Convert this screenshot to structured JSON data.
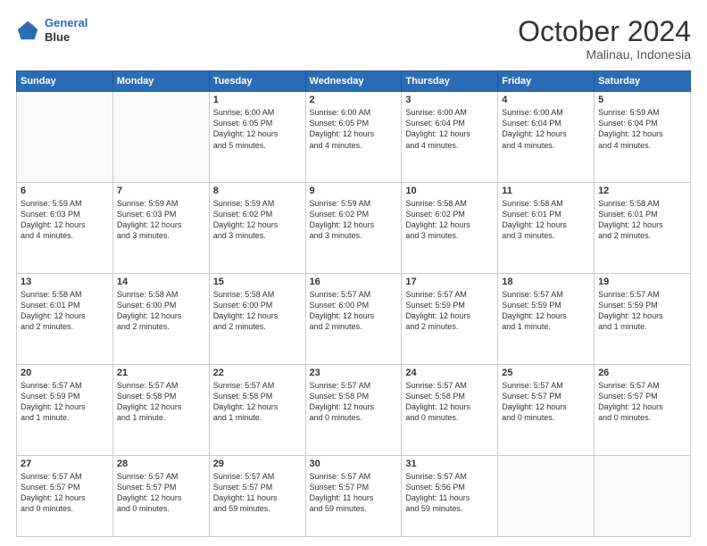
{
  "header": {
    "logo_line1": "General",
    "logo_line2": "Blue",
    "month": "October 2024",
    "location": "Malinau, Indonesia"
  },
  "weekdays": [
    "Sunday",
    "Monday",
    "Tuesday",
    "Wednesday",
    "Thursday",
    "Friday",
    "Saturday"
  ],
  "weeks": [
    [
      {
        "day": "",
        "text": ""
      },
      {
        "day": "",
        "text": ""
      },
      {
        "day": "1",
        "text": "Sunrise: 6:00 AM\nSunset: 6:05 PM\nDaylight: 12 hours\nand 5 minutes."
      },
      {
        "day": "2",
        "text": "Sunrise: 6:00 AM\nSunset: 6:05 PM\nDaylight: 12 hours\nand 4 minutes."
      },
      {
        "day": "3",
        "text": "Sunrise: 6:00 AM\nSunset: 6:04 PM\nDaylight: 12 hours\nand 4 minutes."
      },
      {
        "day": "4",
        "text": "Sunrise: 6:00 AM\nSunset: 6:04 PM\nDaylight: 12 hours\nand 4 minutes."
      },
      {
        "day": "5",
        "text": "Sunrise: 5:59 AM\nSunset: 6:04 PM\nDaylight: 12 hours\nand 4 minutes."
      }
    ],
    [
      {
        "day": "6",
        "text": "Sunrise: 5:59 AM\nSunset: 6:03 PM\nDaylight: 12 hours\nand 4 minutes."
      },
      {
        "day": "7",
        "text": "Sunrise: 5:59 AM\nSunset: 6:03 PM\nDaylight: 12 hours\nand 3 minutes."
      },
      {
        "day": "8",
        "text": "Sunrise: 5:59 AM\nSunset: 6:02 PM\nDaylight: 12 hours\nand 3 minutes."
      },
      {
        "day": "9",
        "text": "Sunrise: 5:59 AM\nSunset: 6:02 PM\nDaylight: 12 hours\nand 3 minutes."
      },
      {
        "day": "10",
        "text": "Sunrise: 5:58 AM\nSunset: 6:02 PM\nDaylight: 12 hours\nand 3 minutes."
      },
      {
        "day": "11",
        "text": "Sunrise: 5:58 AM\nSunset: 6:01 PM\nDaylight: 12 hours\nand 3 minutes."
      },
      {
        "day": "12",
        "text": "Sunrise: 5:58 AM\nSunset: 6:01 PM\nDaylight: 12 hours\nand 2 minutes."
      }
    ],
    [
      {
        "day": "13",
        "text": "Sunrise: 5:58 AM\nSunset: 6:01 PM\nDaylight: 12 hours\nand 2 minutes."
      },
      {
        "day": "14",
        "text": "Sunrise: 5:58 AM\nSunset: 6:00 PM\nDaylight: 12 hours\nand 2 minutes."
      },
      {
        "day": "15",
        "text": "Sunrise: 5:58 AM\nSunset: 6:00 PM\nDaylight: 12 hours\nand 2 minutes."
      },
      {
        "day": "16",
        "text": "Sunrise: 5:57 AM\nSunset: 6:00 PM\nDaylight: 12 hours\nand 2 minutes."
      },
      {
        "day": "17",
        "text": "Sunrise: 5:57 AM\nSunset: 5:59 PM\nDaylight: 12 hours\nand 2 minutes."
      },
      {
        "day": "18",
        "text": "Sunrise: 5:57 AM\nSunset: 5:59 PM\nDaylight: 12 hours\nand 1 minute."
      },
      {
        "day": "19",
        "text": "Sunrise: 5:57 AM\nSunset: 5:59 PM\nDaylight: 12 hours\nand 1 minute."
      }
    ],
    [
      {
        "day": "20",
        "text": "Sunrise: 5:57 AM\nSunset: 5:59 PM\nDaylight: 12 hours\nand 1 minute."
      },
      {
        "day": "21",
        "text": "Sunrise: 5:57 AM\nSunset: 5:58 PM\nDaylight: 12 hours\nand 1 minute."
      },
      {
        "day": "22",
        "text": "Sunrise: 5:57 AM\nSunset: 5:58 PM\nDaylight: 12 hours\nand 1 minute."
      },
      {
        "day": "23",
        "text": "Sunrise: 5:57 AM\nSunset: 5:58 PM\nDaylight: 12 hours\nand 0 minutes."
      },
      {
        "day": "24",
        "text": "Sunrise: 5:57 AM\nSunset: 5:58 PM\nDaylight: 12 hours\nand 0 minutes."
      },
      {
        "day": "25",
        "text": "Sunrise: 5:57 AM\nSunset: 5:57 PM\nDaylight: 12 hours\nand 0 minutes."
      },
      {
        "day": "26",
        "text": "Sunrise: 5:57 AM\nSunset: 5:57 PM\nDaylight: 12 hours\nand 0 minutes."
      }
    ],
    [
      {
        "day": "27",
        "text": "Sunrise: 5:57 AM\nSunset: 5:57 PM\nDaylight: 12 hours\nand 0 minutes."
      },
      {
        "day": "28",
        "text": "Sunrise: 5:57 AM\nSunset: 5:57 PM\nDaylight: 12 hours\nand 0 minutes."
      },
      {
        "day": "29",
        "text": "Sunrise: 5:57 AM\nSunset: 5:57 PM\nDaylight: 11 hours\nand 59 minutes."
      },
      {
        "day": "30",
        "text": "Sunrise: 5:57 AM\nSunset: 5:57 PM\nDaylight: 11 hours\nand 59 minutes."
      },
      {
        "day": "31",
        "text": "Sunrise: 5:57 AM\nSunset: 5:56 PM\nDaylight: 11 hours\nand 59 minutes."
      },
      {
        "day": "",
        "text": ""
      },
      {
        "day": "",
        "text": ""
      }
    ]
  ]
}
